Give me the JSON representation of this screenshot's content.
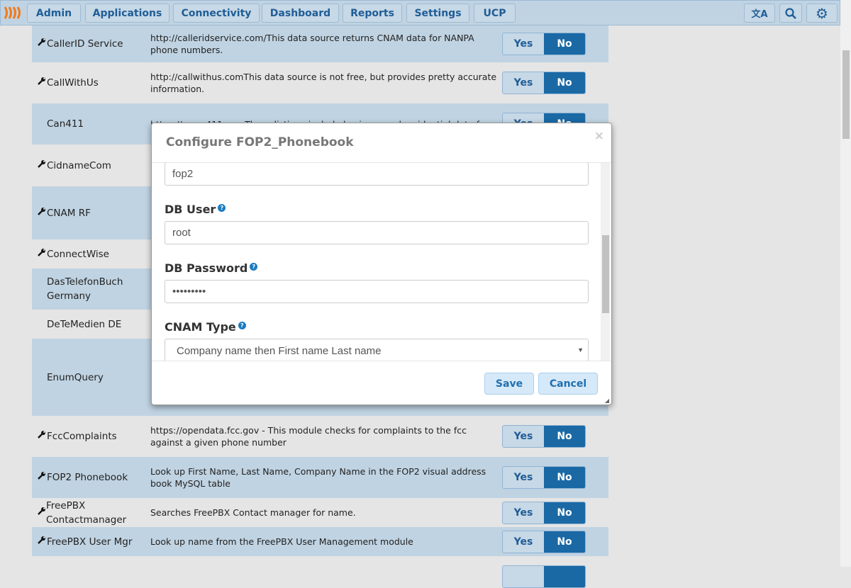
{
  "nav": {
    "items": [
      "Admin",
      "Applications",
      "Connectivity",
      "Dashboard",
      "Reports",
      "Settings",
      "UCP"
    ],
    "icons": [
      "translate-icon",
      "search-icon",
      "gear-icon"
    ]
  },
  "colors": {
    "accent": "#1a69a5",
    "row_alt": "#c0d3e2",
    "background": "#e5e5e5"
  },
  "rows": [
    {
      "name": "CallerID Service",
      "wrench": true,
      "desc": "http://calleridservice.com/This data source returns CNAM data for NANPA phone numbers.",
      "value": "No"
    },
    {
      "name": "CallWithUs",
      "wrench": true,
      "desc": "http://callwithus.comThis data source is not free, but provides pretty accurate information.",
      "value": "No"
    },
    {
      "name": "Can411",
      "wrench": false,
      "desc": "https://www.411.ca - These listings include business and residential data for",
      "value": "No"
    },
    {
      "name": "CidnameCom",
      "wrench": true,
      "desc": ""
    },
    {
      "name": "CNAM RF",
      "wrench": true,
      "desc": ""
    },
    {
      "name": "ConnectWise",
      "wrench": true,
      "desc": ""
    },
    {
      "name": "DasTelefonBuch Germany",
      "wrench": false,
      "desc": ""
    },
    {
      "name": "DeTeMedien DE",
      "wrench": false,
      "desc": ""
    },
    {
      "name": "EnumQuery",
      "wrench": false,
      "desc": ""
    },
    {
      "name": "FccComplaints",
      "wrench": true,
      "desc": "https://opendata.fcc.gov - This module checks for complaints to the fcc against a given phone number",
      "value": "No"
    },
    {
      "name": "FOP2 Phonebook",
      "wrench": true,
      "desc": "Look up First Name, Last Name, Company Name in the FOP2 visual address book MySQL table",
      "value": "No"
    },
    {
      "name": "FreePBX Contactmanager",
      "wrench": true,
      "desc": "Searches FreePBX Contact manager for name.",
      "value": "No"
    },
    {
      "name": "FreePBX User Mgr",
      "wrench": true,
      "desc": "Look up name from the FreePBX User Management module",
      "value": "No"
    }
  ],
  "toggle": {
    "yes": "Yes",
    "no": "No"
  },
  "modal": {
    "title": "Configure FOP2_Phonebook",
    "close": "×",
    "db_name_value": "fop2",
    "db_user_label": "DB User",
    "db_user_value": "root",
    "db_password_label": "DB Password",
    "db_password_value": "•••••••••",
    "cnam_type_label": "CNAM Type",
    "cnam_type_value": "Company  name then First  name Last  name",
    "help": "?",
    "save": "Save",
    "cancel": "Cancel"
  }
}
